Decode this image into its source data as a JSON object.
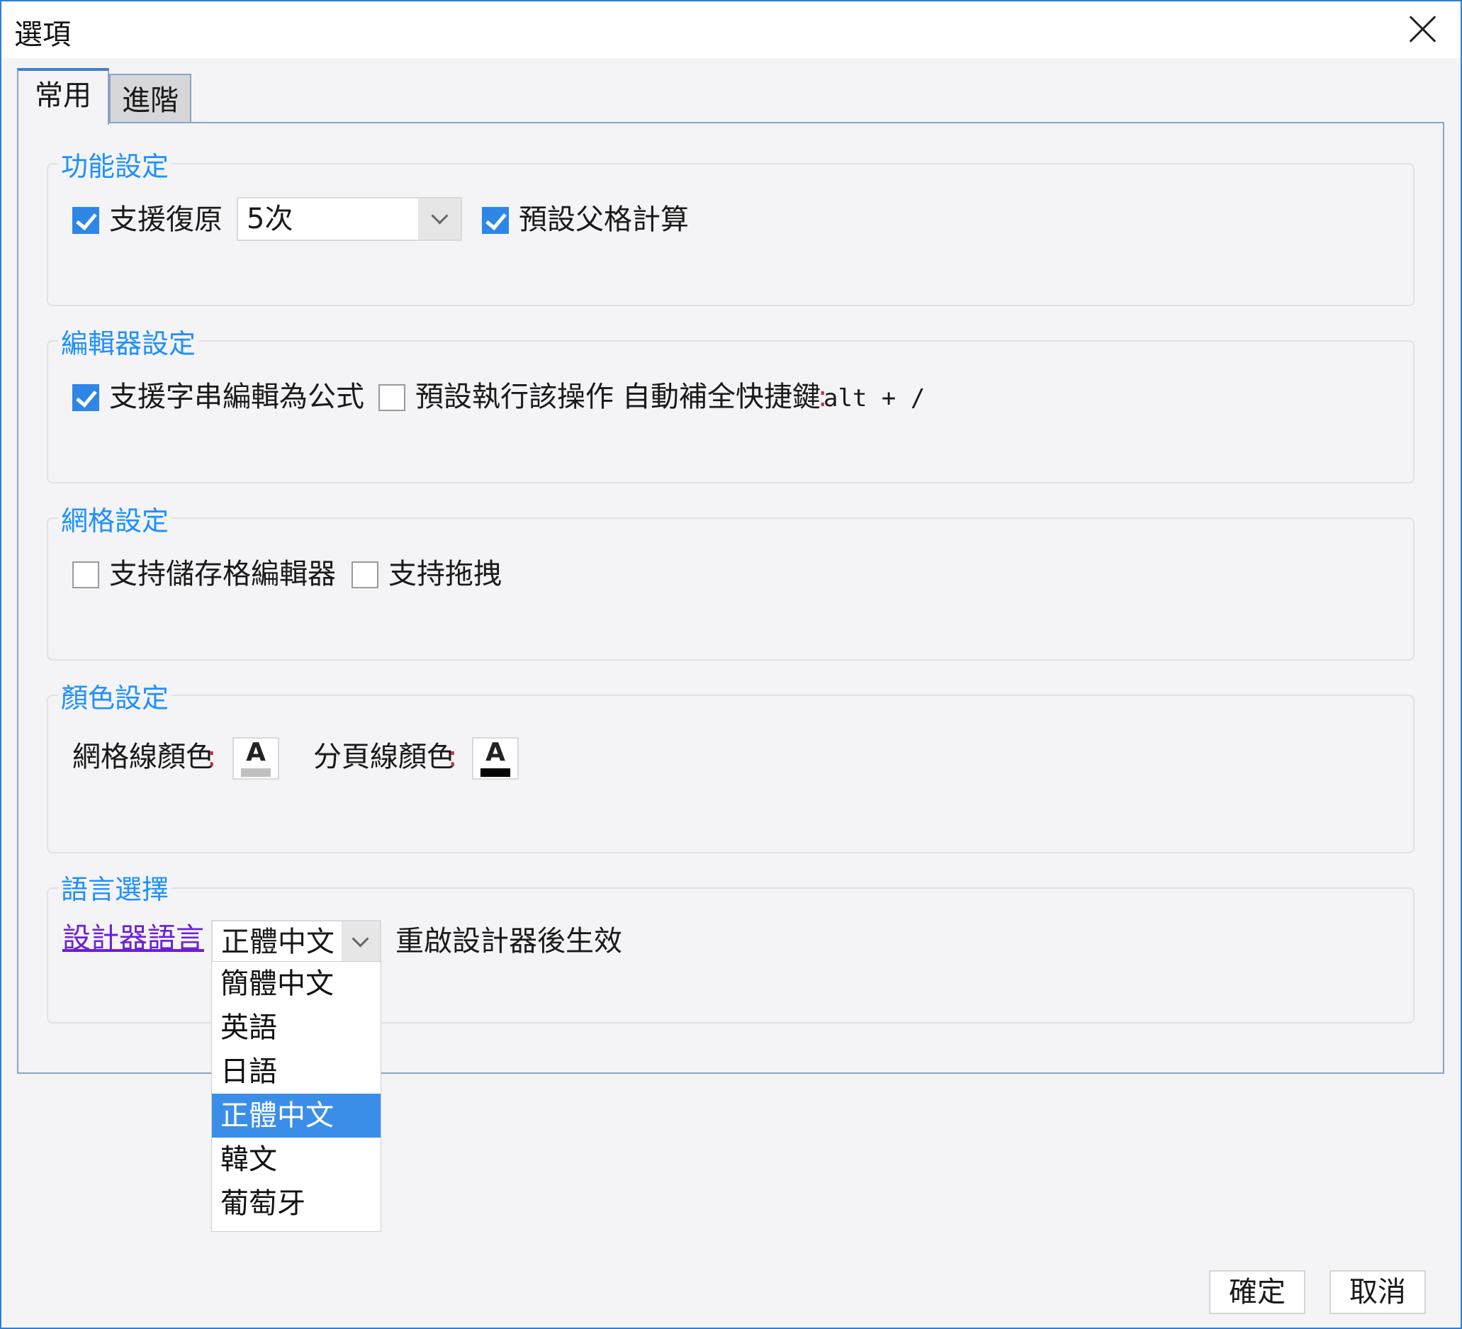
{
  "window": {
    "title": "選項"
  },
  "tabs": [
    {
      "label": "常用",
      "active": true
    },
    {
      "label": "進階",
      "active": false
    }
  ],
  "function_settings": {
    "title": "功能設定",
    "undo": {
      "label": "支援復原",
      "checked": true
    },
    "undo_count": {
      "value": "5次"
    },
    "parent_calc": {
      "label": "預設父格計算",
      "checked": true
    }
  },
  "editor_settings": {
    "title": "編輯器設定",
    "formula": {
      "label": "支援字串編輯為公式",
      "checked": true
    },
    "default_exec": {
      "label": "預設執行該操作",
      "checked": false
    },
    "autocomplete_label": "自動補全快捷鍵",
    "colon": ":",
    "shortcut": "alt + /"
  },
  "grid_settings": {
    "title": "網格設定",
    "cell_editor": {
      "label": "支持儲存格編輯器",
      "checked": false
    },
    "drag": {
      "label": "支持拖拽",
      "checked": false
    }
  },
  "color_settings": {
    "title": "顏色設定",
    "gridline_label": "網格線顏色",
    "pageline_label": "分頁線顏色",
    "colon": ":",
    "glyph": "A",
    "gridline_color": "#c0c0c0",
    "pageline_color": "#000000"
  },
  "language": {
    "title": "語言選擇",
    "label": "設計器語言",
    "value": "正體中文",
    "note": "重啟設計器後生效",
    "options": [
      "簡體中文",
      "英語",
      "日語",
      "正體中文",
      "韓文",
      "葡萄牙"
    ],
    "selected_index": 3
  },
  "footer": {
    "ok": "確定",
    "cancel": "取消"
  },
  "colors": {
    "accent": "#1e90ff",
    "checkbox": "#2e86e6",
    "selection": "#3b8ee8",
    "link": "#6a1fd8"
  }
}
